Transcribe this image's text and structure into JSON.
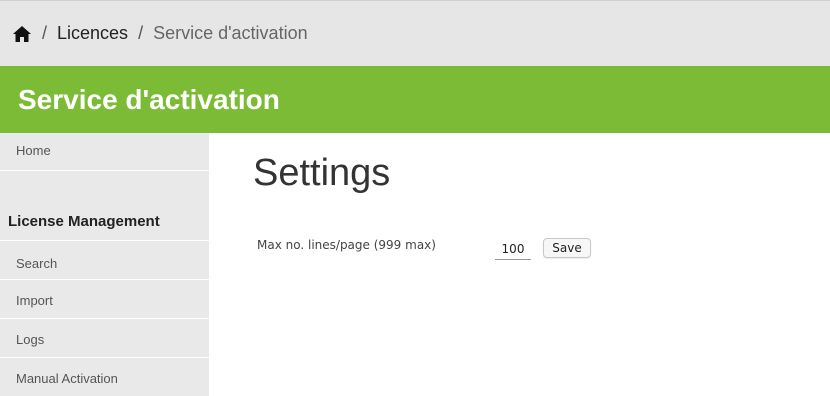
{
  "breadcrumb": {
    "home_icon": "home-icon",
    "separator": "/",
    "items": [
      "Licences",
      "Service d'activation"
    ]
  },
  "header": {
    "title": "Service d'activation",
    "color": "#7cbb36"
  },
  "sidebar": {
    "home_label": "Home",
    "section_heading": "License Management",
    "items": [
      {
        "label": "Search"
      },
      {
        "label": "Import"
      },
      {
        "label": "Logs"
      },
      {
        "label": "Manual Activation"
      }
    ]
  },
  "main": {
    "title": "Settings",
    "setting": {
      "label": "Max no. lines/page (999 max)",
      "value": "100",
      "save_label": "Save"
    }
  }
}
